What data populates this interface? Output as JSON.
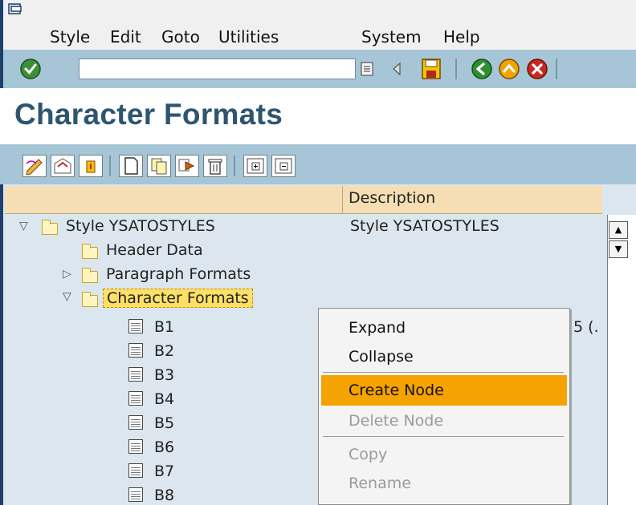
{
  "menu": {
    "items": [
      {
        "label": "Style"
      },
      {
        "label": "Edit"
      },
      {
        "label": "Goto"
      },
      {
        "label": "Utilities"
      },
      {
        "label": "System"
      },
      {
        "label": "Help"
      }
    ]
  },
  "toolbar": {
    "command_field_value": "",
    "icons": [
      "check-icon",
      "command-field-menu-icon",
      "back-arrow-icon",
      "save-icon",
      "green-back-icon",
      "exit-up-icon",
      "cancel-icon"
    ]
  },
  "page": {
    "title": "Character Formats"
  },
  "app_toolbar": {
    "icons": [
      "pencil-icon",
      "display-change-icon",
      "activate-icon",
      "create-icon",
      "copy-icon",
      "move-icon",
      "delete-icon",
      "expand-subtree-icon",
      "collapse-subtree-icon"
    ]
  },
  "tree": {
    "column_headers": [
      "",
      "Description"
    ],
    "rows": [
      {
        "label": "Style YSATOSTYLES",
        "description": "Style YSATOSTYLES"
      },
      {
        "label": "Header Data",
        "description": ""
      },
      {
        "label": "Paragraph Formats",
        "description": ""
      },
      {
        "label": "Character Formats",
        "description": ""
      },
      {
        "label": "B1",
        "description": "5 (."
      },
      {
        "label": "B2",
        "description": ""
      },
      {
        "label": "B3",
        "description": ""
      },
      {
        "label": "B4",
        "description": ""
      },
      {
        "label": "B5",
        "description": ""
      },
      {
        "label": "B6",
        "description": ""
      },
      {
        "label": "B7",
        "description": ""
      },
      {
        "label": "B8",
        "description": ""
      }
    ]
  },
  "context_menu": {
    "items": [
      {
        "label": "Expand",
        "enabled": true
      },
      {
        "label": "Collapse",
        "enabled": true
      },
      {
        "label": "Create Node",
        "enabled": true,
        "highlighted": true
      },
      {
        "label": "Delete Node",
        "enabled": false
      },
      {
        "label": "Copy",
        "enabled": false
      },
      {
        "label": "Rename",
        "enabled": false
      }
    ]
  },
  "colors": {
    "toolbar_bg": "#a6c6d7",
    "title_text": "#2e5570",
    "header_bg": "#f5deb3",
    "tree_bg": "#dbe6ee",
    "highlight": "#f5a300",
    "selected_node_bg": "#ffe066"
  }
}
